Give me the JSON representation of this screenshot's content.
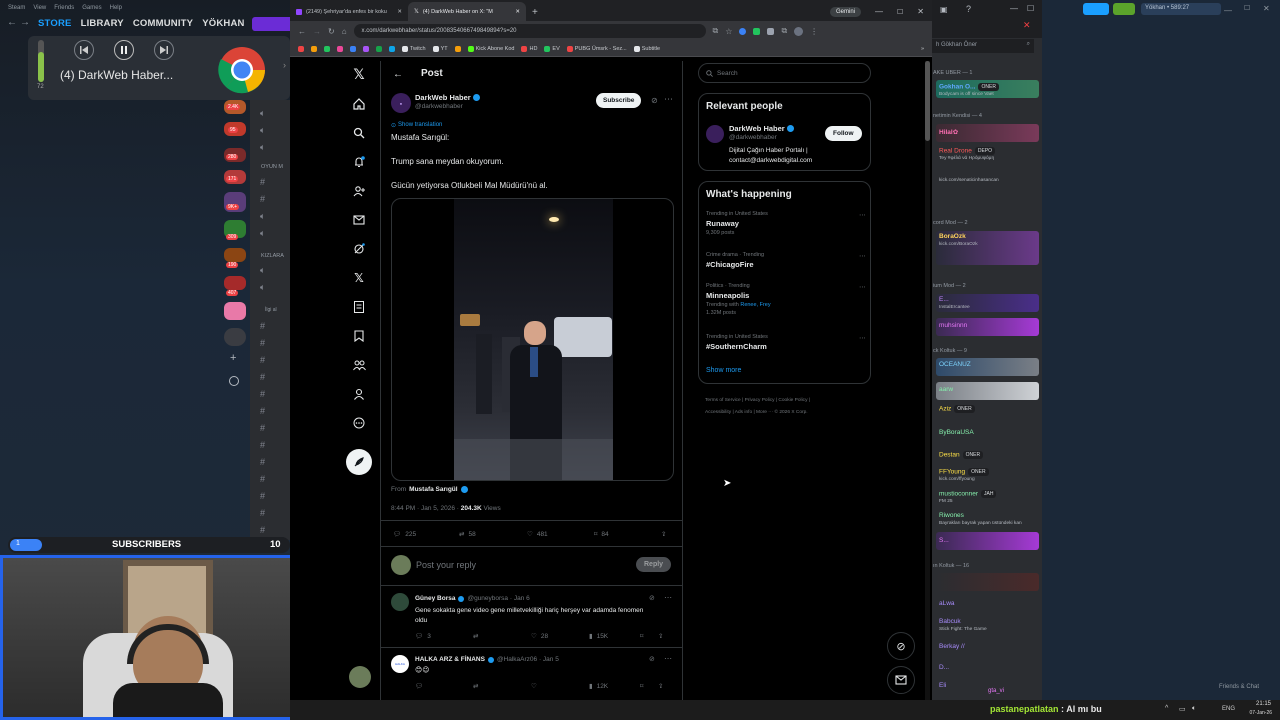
{
  "steam": {
    "menu": [
      "Steam",
      "View",
      "Friends",
      "Games",
      "Help"
    ],
    "nav": [
      "STORE",
      "LIBRARY",
      "COMMUNITY",
      "YÖKHAN"
    ],
    "subscribers_label": "SUBSCRIBERS",
    "subscribers_count": "10",
    "subscribers_progress": "1",
    "volume": "72"
  },
  "media": {
    "title": "(4) DarkWeb Haber..."
  },
  "discord_channels": {
    "groups": [
      "OYUN M",
      "KIZLARA",
      "İlgi al"
    ],
    "badges": [
      "2.4K",
      "95",
      "280",
      "171",
      "9K+",
      "309",
      "190",
      "407"
    ]
  },
  "browser": {
    "tabs": [
      {
        "title": "(2149) Şehriyar'da enfes bir koku"
      },
      {
        "title": "(4) DarkWeb Haber on X: \"M"
      }
    ],
    "url": "x.com/darkwebhaber/status/2008354066749849894?s=20",
    "gemini": "Gemini",
    "bookmarks": [
      "Twitch",
      "YT",
      "Kick Abone Kod",
      "HD",
      "EV",
      "PUBG Ümsrk - Sez...",
      "Subtitle"
    ]
  },
  "x": {
    "header": "Post",
    "author": {
      "name": "DarkWeb Haber",
      "handle": "@darkwebhaber"
    },
    "subscribe": "Subscribe",
    "show_translation": "Show translation",
    "body": [
      "Mustafa Sarıgül:",
      "Trump sana meydan okuyorum.",
      "Gücün yetiyorsa Otlukbeli Mal Müdürü'nü al."
    ],
    "from_label": "From",
    "from_name": "Mustafa Sarıgül",
    "time": "8:44 PM · Jan 5, 2026 · ",
    "views": "204.3K",
    "views_label": " Views",
    "stats": {
      "replies": "225",
      "reposts": "58",
      "likes": "481",
      "bookmarks": "84"
    },
    "reply_placeholder": "Post your reply",
    "reply_button": "Reply",
    "replies": [
      {
        "name": "Güney Borsa",
        "handle": "@guneyborsa · Jan 6",
        "text": "Gene sokakta gene video gene milletvekilliği hariç herşey var adamda fenomen oldu",
        "r": "3",
        "rp": "",
        "l": "28",
        "v": "15K"
      },
      {
        "name": "HALKA ARZ & FİNANS",
        "handle": "@HalkaArz06 · Jan 5",
        "text": "😊😉",
        "r": "",
        "rp": "",
        "l": "",
        "v": "12K"
      }
    ],
    "search_placeholder": "Search",
    "relevant_title": "Relevant people",
    "rel_name": "DarkWeb Haber",
    "rel_handle": "@darkwebhaber",
    "follow": "Follow",
    "rel_bio": "Dijital Çağın Haber Portalı | contact@darkwebdigital.com",
    "happening_title": "What's happening",
    "trends": [
      {
        "ctx": "Trending in United States",
        "name": "Runaway",
        "posts": "9,309 posts"
      },
      {
        "ctx": "Crime drama · Trending",
        "name": "#ChicagoFire",
        "posts": ""
      },
      {
        "ctx": "Politics · Trending",
        "name": "Minneapolis",
        "posts": "1.32M posts",
        "with": "Trending with",
        "withlinks": "Renee, Frey"
      },
      {
        "ctx": "Trending in United States",
        "name": "#SouthernCharm",
        "posts": ""
      }
    ],
    "show_more": "Show more",
    "footer": [
      "Terms of Service",
      "Privacy Policy",
      "Cookie Policy",
      "Accessibility",
      "Ads info",
      "More ···",
      "© 2026 X Corp."
    ]
  },
  "discord_right": {
    "search": "h Gökhan Öner",
    "user": "Yökhan • 589:27",
    "sections": [
      "AKE UBER — 1",
      "netimin Kendisi — 4",
      "cord Mod — 2",
      "ium Mod — 2",
      "ck Koltuk — 9",
      "ın Koltuk — 16"
    ],
    "members": [
      {
        "name": "Gokhan O...",
        "tag": "ONER",
        "color": "#5fa8ff"
      },
      {
        "name": "Hilal✿",
        "tag": "",
        "color": "#ff6fb3"
      },
      {
        "name": "Real Drone",
        "tag": "DEPO",
        "color": "#ff5a5a"
      },
      {
        "name": "BoraOzk",
        "tag": "",
        "color": "#ffd35c"
      },
      {
        "name": "E...",
        "tag": "",
        "color": "#c084fc"
      },
      {
        "name": "muhsinnn",
        "tag": "",
        "color": "#e879f9"
      },
      {
        "name": "OCEANUZ",
        "tag": "",
        "color": "#7dd3fc"
      },
      {
        "name": "aarw",
        "tag": "",
        "color": "#86efac"
      },
      {
        "name": "Aziz",
        "tag": "ONER",
        "color": "#fde047"
      },
      {
        "name": "ByBoraUSA",
        "tag": "",
        "color": "#86efac"
      },
      {
        "name": "Destan",
        "tag": "ONER",
        "color": "#fde047"
      },
      {
        "name": "FFYoung",
        "tag": "ONER",
        "color": "#fde047"
      },
      {
        "name": "mustioconner",
        "tag": "JAH",
        "color": "#86efac"
      },
      {
        "name": "Riwones",
        "tag": "",
        "color": "#86efac"
      },
      {
        "name": "S...",
        "tag": "",
        "color": "#e879f9"
      },
      {
        "name": "aLwa",
        "tag": "",
        "color": "#a78bfa"
      },
      {
        "name": "Babcuk",
        "tag": "",
        "color": "#a78bfa"
      },
      {
        "name": "Berkay //",
        "tag": "",
        "color": "#a78bfa"
      },
      {
        "name": "D...",
        "tag": "",
        "color": "#a78bfa"
      },
      {
        "name": "Eli",
        "tag": "",
        "color": "#a78bfa"
      }
    ],
    "sub_texts": [
      "Bodycam is off since Vaet",
      "Tey #φέλά νά Ηρόμυφόμη",
      "kick.com/senaticinhasancan",
      "kick.com/BoraOzk",
      "InstalErcantee",
      "Bayrakları bayrak yapan üstündeki kan",
      "Stick Fight: The Game",
      "FM 25",
      "kick.com/ffyoung"
    ],
    "gta": "gta_vi",
    "friends_chat": "Friends & Chat"
  },
  "chat_overlay": {
    "user": "pastanepatlatan",
    "message": "Al mı bu"
  },
  "clock": {
    "time": "21:15",
    "date": "07-Jan-26",
    "lang": "ENG"
  }
}
